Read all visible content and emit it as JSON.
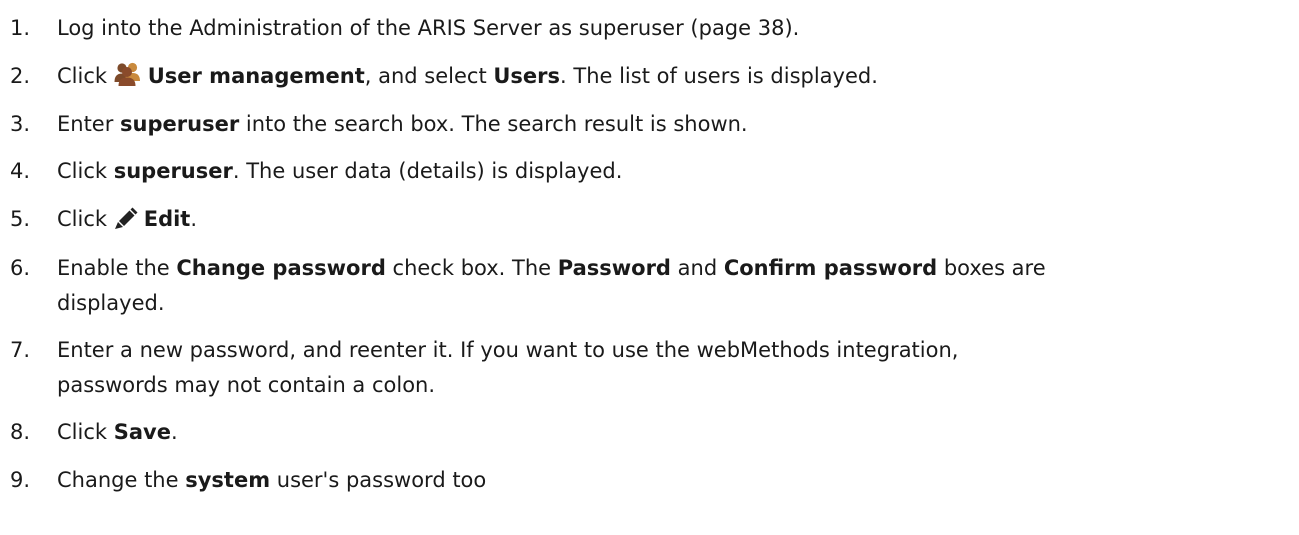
{
  "steps": [
    {
      "num": "1.",
      "parts": [
        "Log into the Administration of the ARIS Server as superuser (page 38)."
      ]
    },
    {
      "num": "2.",
      "icon": "users-group-icon",
      "parts": [
        "Click ",
        "User management",
        ", and select ",
        "Users",
        ". The list of users is displayed."
      ]
    },
    {
      "num": "3.",
      "parts": [
        "Enter ",
        "superuser",
        " into the search box. The search result is shown."
      ]
    },
    {
      "num": "4.",
      "parts": [
        "Click ",
        "superuser",
        ". The user data (details) is displayed."
      ]
    },
    {
      "num": "5.",
      "icon": "pencil-edit-icon",
      "parts": [
        "Click ",
        "Edit",
        "."
      ]
    },
    {
      "num": "6.",
      "parts": [
        "Enable the ",
        "Change password",
        " check box. The ",
        "Password",
        " and ",
        "Confirm password",
        " boxes are",
        "displayed."
      ]
    },
    {
      "num": "7.",
      "parts": [
        "Enter a new password, and reenter it. If you want to use the webMethods integration,",
        "passwords may not contain a colon."
      ]
    },
    {
      "num": "8.",
      "parts": [
        "Click ",
        "Save",
        "."
      ]
    },
    {
      "num": "9.",
      "parts": [
        "Change the ",
        "system",
        " user's password too"
      ]
    }
  ]
}
